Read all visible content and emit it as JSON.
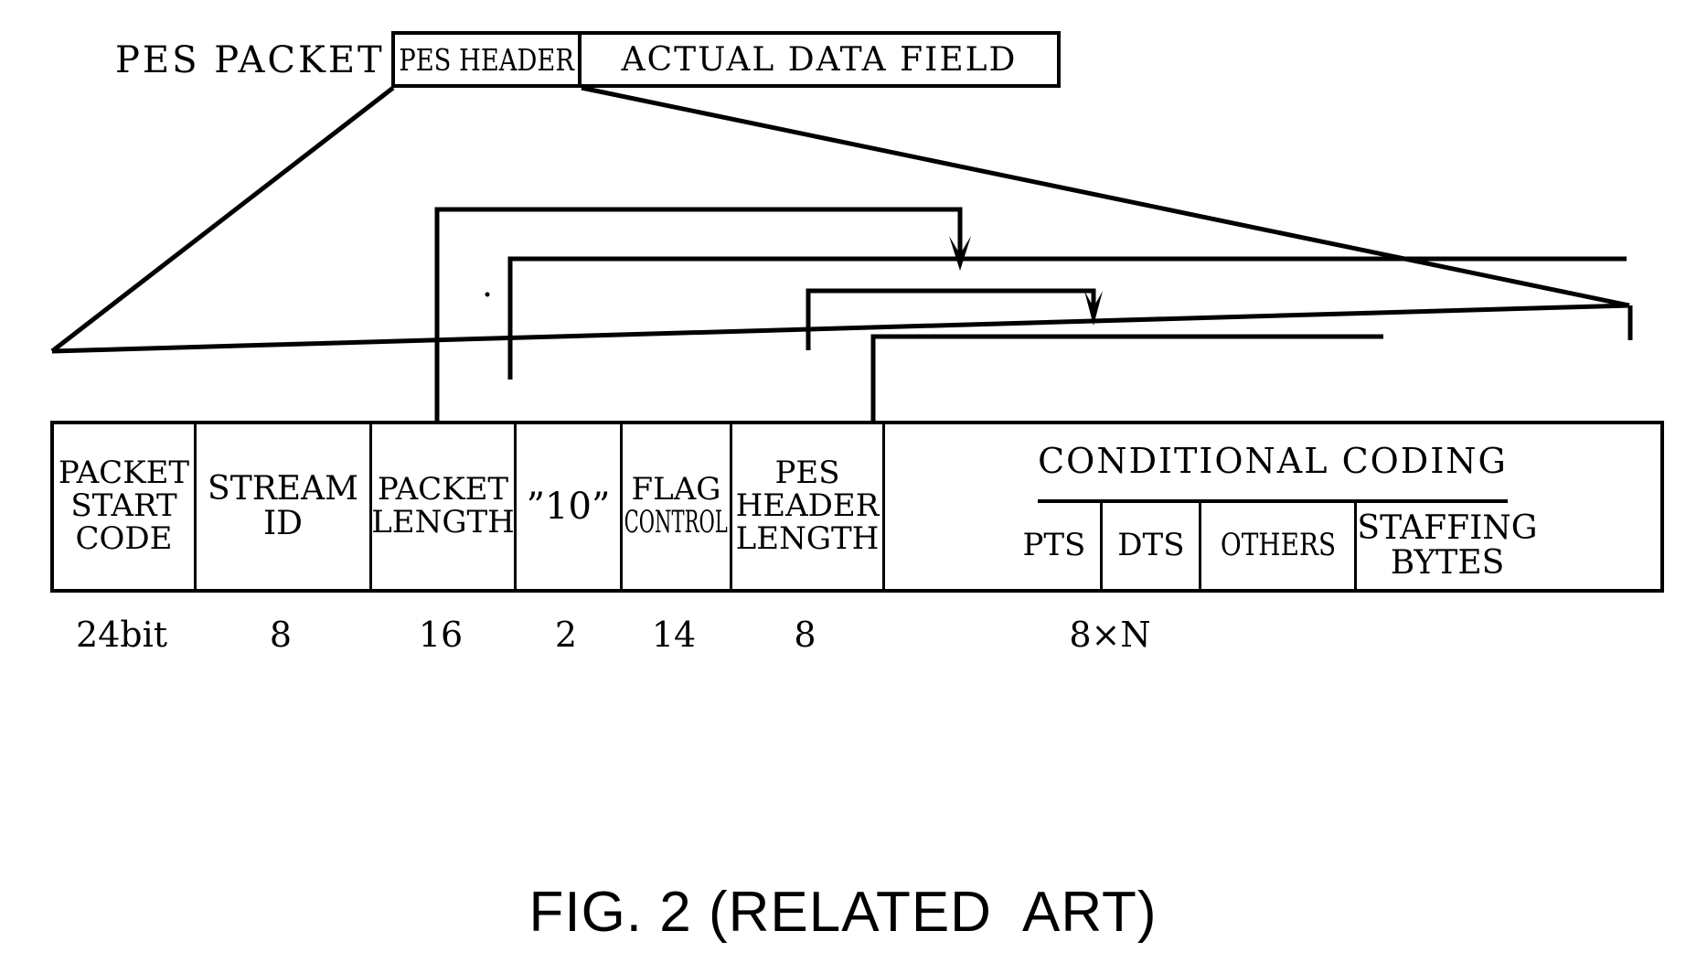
{
  "figure": {
    "caption": "FIG. 2 (RELATED  ART)",
    "top_label": "PES PACKET"
  },
  "top_row": {
    "cells": [
      {
        "label": "PES HEADER",
        "name": "pes-header"
      },
      {
        "label": "ACTUAL DATA FIELD",
        "name": "actual-data-field"
      }
    ]
  },
  "main_table": {
    "fields": [
      {
        "name": "packet-start-code",
        "lines": [
          "PACKET",
          "START",
          "CODE"
        ],
        "bits": "24bit"
      },
      {
        "name": "stream-id",
        "lines": [
          "STREAM",
          "ID"
        ],
        "bits": "8"
      },
      {
        "name": "packet-length",
        "lines": [
          "PACKET",
          "LENGTH"
        ],
        "bits": "16"
      },
      {
        "name": "ten-marker",
        "lines": [
          "”10”"
        ],
        "bits": "2"
      },
      {
        "name": "flag-control",
        "lines": [
          "FLAG",
          "CONTROL"
        ],
        "bits": "14"
      },
      {
        "name": "pes-header-length",
        "lines": [
          "PES",
          "HEADER",
          "LENGTH"
        ],
        "bits": "8"
      },
      {
        "name": "conditional-coding",
        "lines": [
          "CONDITIONAL CODING"
        ],
        "bits": "8×N"
      }
    ],
    "conditional_coding": {
      "title": "CONDITIONAL CODING",
      "sub_fields": [
        {
          "name": "pts",
          "lines": [
            "PTS"
          ]
        },
        {
          "name": "dts",
          "lines": [
            "DTS"
          ]
        },
        {
          "name": "others",
          "lines": [
            "OTHERS"
          ]
        },
        {
          "name": "staffing-bytes",
          "lines": [
            "STAFFING",
            "BYTES"
          ]
        }
      ]
    },
    "bit_labels": [
      "24bit",
      "8",
      "16",
      "2",
      "14",
      "8",
      "8×N"
    ]
  },
  "colors": {
    "line": "#000000",
    "background": "#ffffff"
  }
}
